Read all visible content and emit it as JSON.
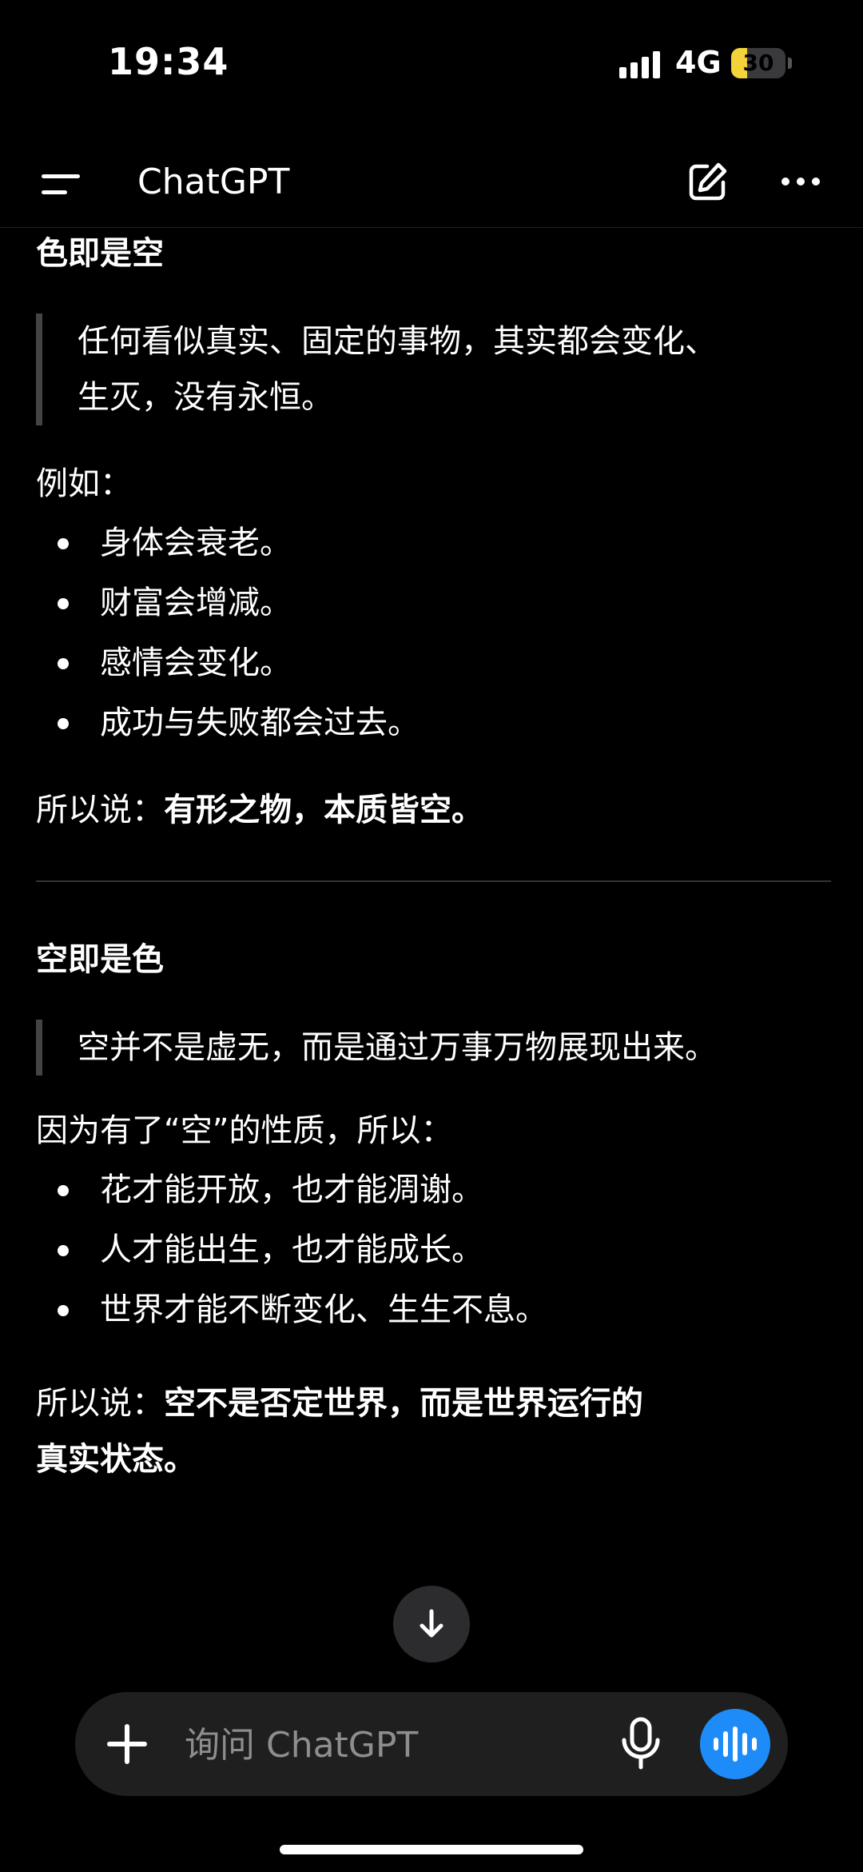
{
  "status_bar": {
    "time": "19:34",
    "network": "4G",
    "battery": "30",
    "battery_level_percent": 30
  },
  "header": {
    "title": "ChatGPT"
  },
  "message": {
    "section1": {
      "heading": "色即是空",
      "quote_lines": [
        "任何看似真实、固定的事物，其实都会变化、",
        "生灭，没有永恒。"
      ],
      "intro": "例如：",
      "bullets": [
        "身体会衰老。",
        "财富会增减。",
        "感情会变化。",
        "成功与失败都会过去。"
      ],
      "conclusion_prefix": "所以说：",
      "conclusion_bold": "有形之物，本质皆空。"
    },
    "section2": {
      "heading": "空即是色",
      "quote_lines": [
        "空并不是虚无，而是通过万事万物展现出来。"
      ],
      "intro": "因为有了“空”的性质，所以：",
      "bullets": [
        "花才能开放，也才能凋谢。",
        "人才能出生，也才能成长。",
        "世界才能不断变化、生生不息。"
      ],
      "conclusion_prefix": "所以说：",
      "conclusion_bold_line1": "空不是否定世界，而是世界运行的",
      "conclusion_bold_line2": "真实状态。"
    }
  },
  "composer": {
    "placeholder": "询问 ChatGPT"
  },
  "icons": {
    "menu": "menu-icon",
    "edit": "edit-icon",
    "more": "more-icon",
    "scroll_down": "arrow-down-icon",
    "plus": "plus-icon",
    "mic": "mic-icon",
    "voice": "voice-waveform-icon"
  },
  "colors": {
    "background": "#000000",
    "accent": "#1d8cf8",
    "battery": "#f2d33a"
  }
}
